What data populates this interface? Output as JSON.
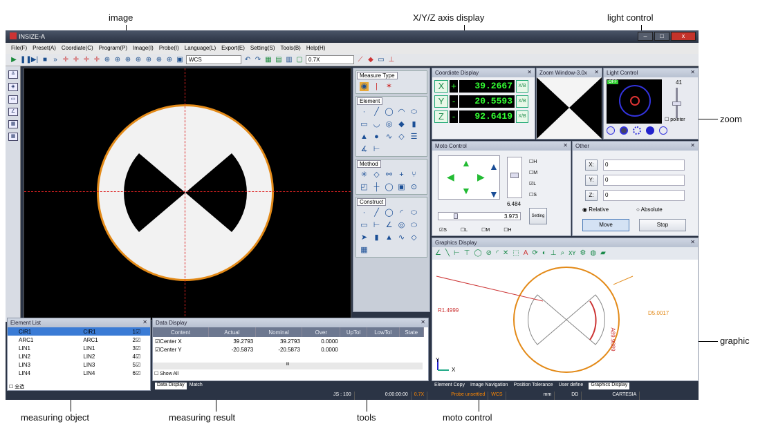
{
  "annotations": {
    "image": "image",
    "xyz": "X/Y/Z axis display",
    "light": "light control",
    "zoom": "zoom",
    "graphic": "graphic",
    "measuring_object": "measuring object",
    "measuring_result": "measuring result",
    "tools": "tools",
    "moto_control": "moto control"
  },
  "app": {
    "title": "INSIZE-A"
  },
  "menu": [
    "File(F)",
    "Preset(A)",
    "Coordiate(C)",
    "Program(P)",
    "Image(I)",
    "Probe(I)",
    "Language(L)",
    "Export(E)",
    "Setting(S)",
    "Tools(B)",
    "Help(H)"
  ],
  "toolbar": {
    "coord_system": "WCS",
    "zoom": "0.7X"
  },
  "measure_type": {
    "title": "Measure Type",
    "element": "Element",
    "method": "Method",
    "construct": "Construct"
  },
  "coordinate": {
    "title": "Coordiate Display",
    "x": "+",
    "x_val": "39.2667",
    "y": "-",
    "y_val": "20.5593",
    "z": "-",
    "z_val": "92.6419",
    "unit": "X/B"
  },
  "zoom_window": {
    "title": "Zoom Window-3.0x"
  },
  "light": {
    "title": "Light Control",
    "off": "OFF",
    "value": "41",
    "pointer": "pointer"
  },
  "moto": {
    "title": "Moto Control",
    "speed": "6.484",
    "slider_val": "3.973",
    "setting": "Setting",
    "checks": [
      "H",
      "M",
      "L",
      "S"
    ],
    "bottom": [
      "S",
      "L",
      "M",
      "H"
    ]
  },
  "other": {
    "title": "Other",
    "x": "X:",
    "xv": "0",
    "y": "Y:",
    "yv": "0",
    "z": "Z:",
    "zv": "0",
    "relative": "Relative",
    "absolute": "Absolute",
    "move": "Move",
    "stop": "Stop"
  },
  "graphics": {
    "title": "Graphics Display",
    "radius": "R1.4999",
    "diameter": "D5.0017",
    "angle": "A89.9889",
    "y": "Y",
    "x": "X"
  },
  "element_list": {
    "title": "Element List",
    "rows": [
      [
        "CIR1",
        "CIR1",
        "1"
      ],
      [
        "ARC1",
        "ARC1",
        "2"
      ],
      [
        "LIN1",
        "LIN1",
        "3"
      ],
      [
        "LIN2",
        "LIN2",
        "4"
      ],
      [
        "LIN3",
        "LIN3",
        "5"
      ],
      [
        "LIN4",
        "LIN4",
        "6"
      ]
    ],
    "footer": "全选"
  },
  "data_display": {
    "title": "Data Display",
    "headers": [
      "Content",
      "Actual",
      "Nominal",
      "Over",
      "UpTol",
      "LowTol",
      "State"
    ],
    "rows": [
      [
        "Center X",
        "39.2793",
        "39.2793",
        "0.0000"
      ],
      [
        "Center Y",
        "-20.5873",
        "-20.5873",
        "0.0000"
      ]
    ],
    "show_all": "Show All",
    "tabs": [
      "Data Display",
      "Match"
    ],
    "scroll_mid": "III"
  },
  "right_tabs": [
    "Element Copy",
    "Image Navigation",
    "Position Tolerance",
    "User define",
    "Graphics Display"
  ],
  "status": [
    "JS : 100",
    "0:00:00:00",
    "0.7X",
    "Probe unsettled",
    "WCS",
    "mm",
    "DD",
    "CARTESIA"
  ]
}
